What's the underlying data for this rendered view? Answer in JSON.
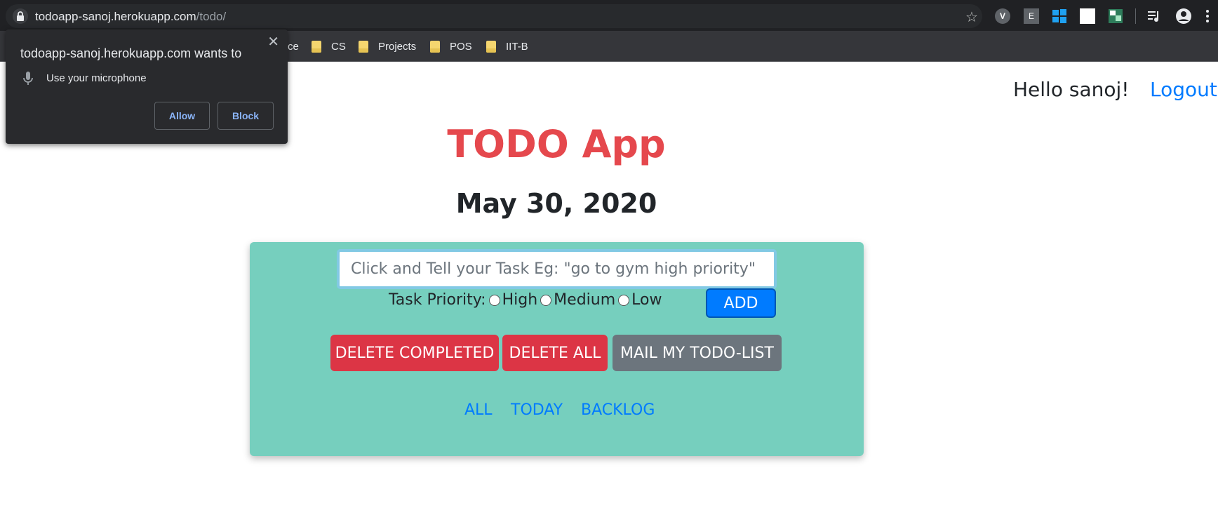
{
  "browser": {
    "url_host": "todoapp-sanoj.herokuapp.com",
    "url_path": "/todo/",
    "bookmarks": [
      {
        "label": "ce",
        "folder": false
      },
      {
        "label": "CS",
        "folder": true
      },
      {
        "label": "Projects",
        "folder": true
      },
      {
        "label": "POS",
        "folder": true
      },
      {
        "label": "IIT-B",
        "folder": true
      }
    ],
    "extensions": {
      "v_badge": "V",
      "e_badge": "E"
    }
  },
  "permission_popup": {
    "title": "todoapp-sanoj.herokuapp.com wants to",
    "permission": "Use your microphone",
    "allow_label": "Allow",
    "block_label": "Block",
    "close_symbol": "✕"
  },
  "header": {
    "greeting": "Hello sanoj!",
    "logout_label": "Logout"
  },
  "app": {
    "title": "TODO App",
    "date": "May 30, 2020",
    "colors": {
      "title": "#e5484d",
      "card": "#76cfbe",
      "danger": "#dc3545",
      "secondary": "#6c757d",
      "primary": "#007bff"
    }
  },
  "task_form": {
    "placeholder": "Click and Tell your Task Eg: \"go to gym high priority\"",
    "value": "",
    "priority_label": "Task Priority:",
    "priorities": [
      "High",
      "Medium",
      "Low"
    ],
    "add_label": "ADD"
  },
  "actions": {
    "delete_completed": "DELETE COMPLETED",
    "delete_all": "DELETE ALL",
    "mail": "MAIL MY TODO-LIST"
  },
  "filters": [
    "ALL",
    "TODAY",
    "BACKLOG"
  ]
}
